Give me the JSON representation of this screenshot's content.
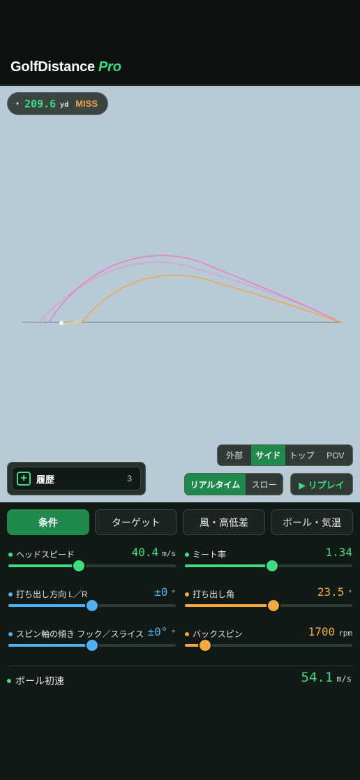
{
  "app": {
    "title": "GolfDistance",
    "title_suffix": "Pro"
  },
  "shot": {
    "distance": "209.6",
    "unit": "yd",
    "result": "MISS",
    "caret": "▾"
  },
  "history": {
    "label": "履歴",
    "count": "3"
  },
  "view_modes": [
    "外部",
    "サイド",
    "トップ",
    "POV"
  ],
  "view_active": "サイド",
  "speed_modes": [
    "リアルタイム",
    "スロー"
  ],
  "speed_active": "リアルタイム",
  "replay_label": "▶ リプレイ",
  "tabs": [
    "条件",
    "ターゲット",
    "風・高低差",
    "ボール・気温"
  ],
  "tab_active": "条件",
  "params": {
    "head_speed": {
      "label": "ヘッドスピード",
      "value": "40.4",
      "unit": "m/s",
      "level": 0.42
    },
    "smash": {
      "label": "ミート率",
      "value": "1.34",
      "unit": "",
      "level": 0.52
    },
    "launch_dir": {
      "label": "打ち出し方向 L／R",
      "value": "±0",
      "unit": "°",
      "level": 0.5
    },
    "launch_angle": {
      "label": "打ち出し角",
      "value": "23.5",
      "unit": "°",
      "level": 0.53
    },
    "spin_axis": {
      "label": "スピン軸の傾き フック／スライス",
      "value": "±0°",
      "unit": "°",
      "level": 0.5
    },
    "backspin": {
      "label": "バックスピン",
      "value": "1700",
      "unit": "rpm",
      "level": 0.12
    }
  },
  "ball_speed": {
    "label": "ボール初速",
    "value": "54.1",
    "unit": "m/s"
  },
  "colors": {
    "accent": "#3ddc84",
    "blue": "#4fb0f0",
    "orange": "#f5a83f",
    "miss": "#f0a04b"
  }
}
